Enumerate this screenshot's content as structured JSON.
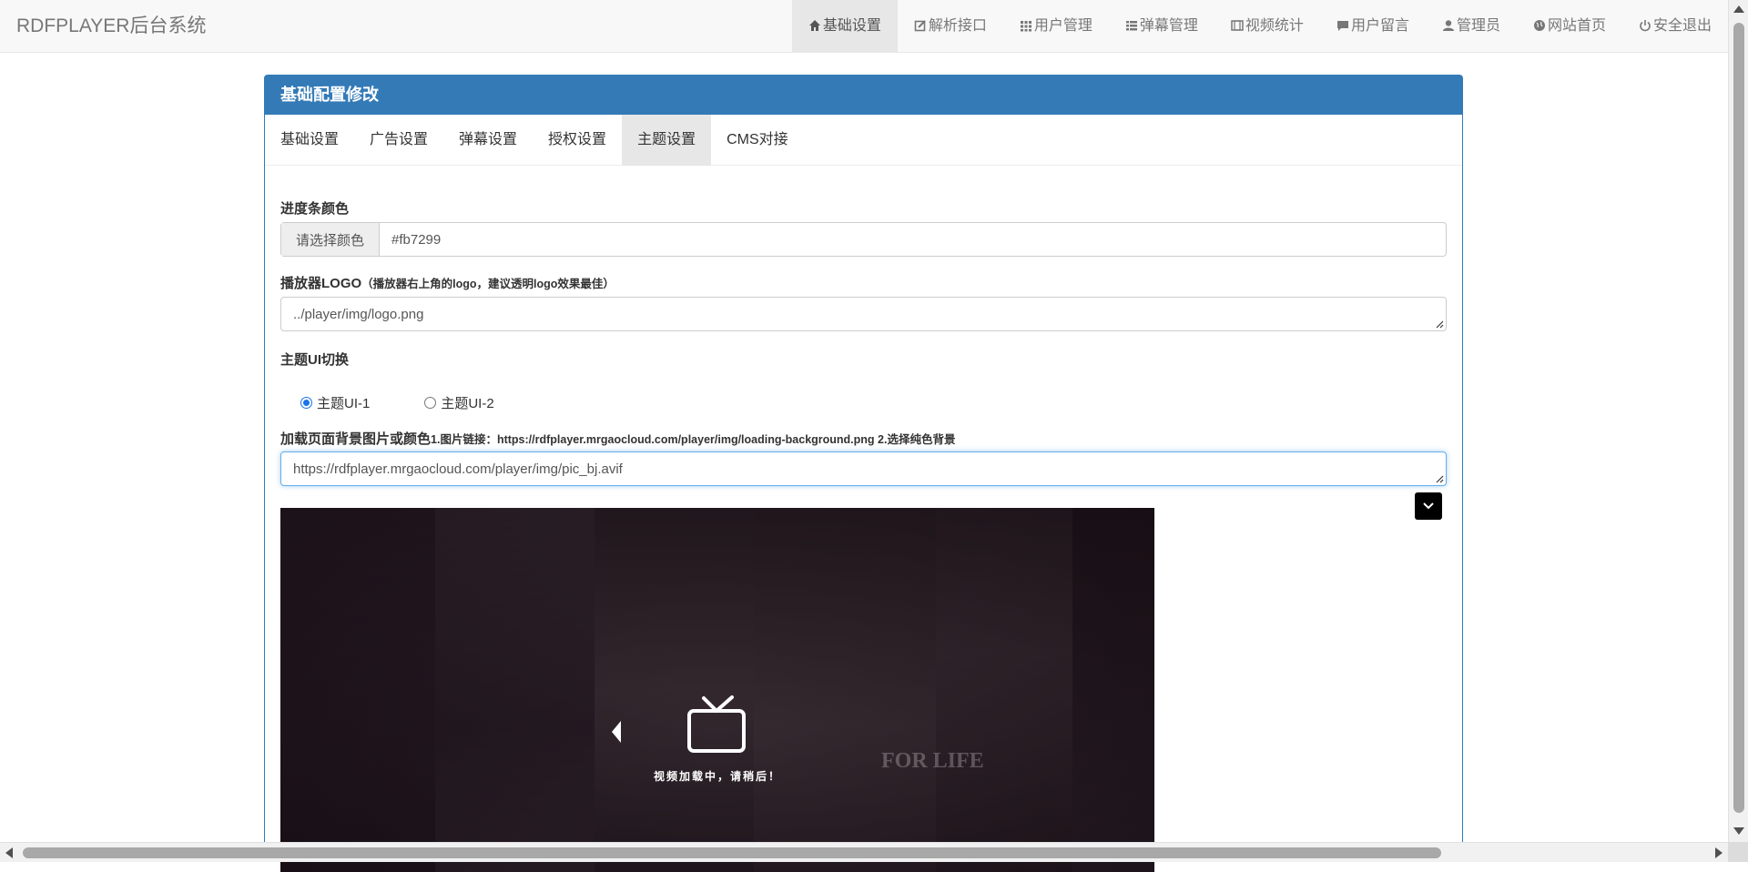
{
  "app": {
    "title": "RDFPLAYER后台系统"
  },
  "nav": {
    "items": [
      {
        "label": "基础设置",
        "icon": "home-icon",
        "active": true
      },
      {
        "label": "解析接口",
        "icon": "edit-icon",
        "active": false
      },
      {
        "label": "用户管理",
        "icon": "grid-icon",
        "active": false
      },
      {
        "label": "弹幕管理",
        "icon": "list-icon",
        "active": false
      },
      {
        "label": "视频统计",
        "icon": "film-icon",
        "active": false
      },
      {
        "label": "用户留言",
        "icon": "comment-icon",
        "active": false
      },
      {
        "label": "管理员",
        "icon": "user-icon",
        "active": false
      },
      {
        "label": "网站首页",
        "icon": "globe-icon",
        "active": false
      },
      {
        "label": "安全退出",
        "icon": "power-icon",
        "active": false
      }
    ]
  },
  "panel": {
    "heading": "基础配置修改",
    "accent": "#337ab7",
    "tabs": [
      {
        "label": "基础设置",
        "active": false
      },
      {
        "label": "广告设置",
        "active": false
      },
      {
        "label": "弹幕设置",
        "active": false
      },
      {
        "label": "授权设置",
        "active": false
      },
      {
        "label": "主题设置",
        "active": true
      },
      {
        "label": "CMS对接",
        "active": false
      }
    ]
  },
  "form": {
    "progress_color": {
      "label": "进度条颜色",
      "addon": "请选择颜色",
      "value": "#fb7299"
    },
    "logo": {
      "label": "播放器LOGO",
      "hint": "（播放器右上角的logo，建议透明logo效果最佳）",
      "value": "../player/img/logo.png"
    },
    "theme_ui": {
      "label": "主题UI切换",
      "options": [
        {
          "label": "主题UI-1",
          "checked": true
        },
        {
          "label": "主题UI-2",
          "checked": false
        }
      ]
    },
    "loading_bg": {
      "label": "加载页面背景图片或颜色",
      "hint": "1.图片链接：https://rdfplayer.mrgaocloud.com/player/img/loading-background.png 2.选择纯色背景",
      "value": "https://rdfplayer.mrgaocloud.com/player/img/pic_bj.avif"
    }
  },
  "preview": {
    "loading_text": "视频加载中，请稍后！",
    "poster_text": "FOR LIFE"
  }
}
